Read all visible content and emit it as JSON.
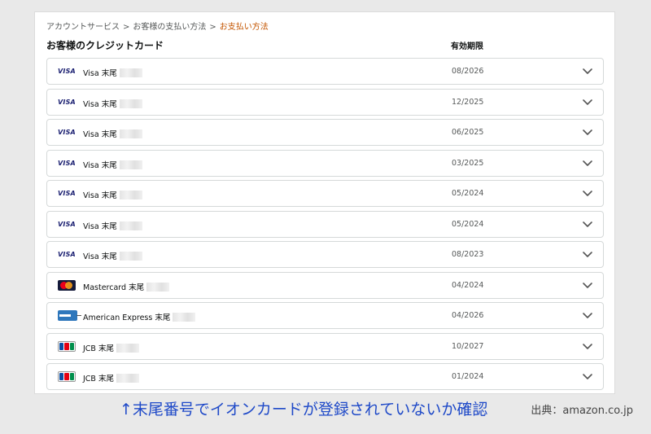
{
  "breadcrumb": {
    "items": [
      "アカウントサービス",
      "お客様の支払い方法"
    ],
    "separator": ">",
    "current": "お支払い方法"
  },
  "section_title": "お客様のクレジットカード",
  "expiry_header": "有効期限",
  "cards": [
    {
      "brand": "visa",
      "logo_text": "VISA",
      "label": "Visa 末尾",
      "expiry": "08/2026"
    },
    {
      "brand": "visa",
      "logo_text": "VISA",
      "label": "Visa 末尾",
      "expiry": "12/2025"
    },
    {
      "brand": "visa",
      "logo_text": "VISA",
      "label": "Visa 末尾",
      "expiry": "06/2025"
    },
    {
      "brand": "visa",
      "logo_text": "VISA",
      "label": "Visa 末尾",
      "expiry": "03/2025"
    },
    {
      "brand": "visa",
      "logo_text": "VISA",
      "label": "Visa 末尾",
      "expiry": "05/2024"
    },
    {
      "brand": "visa",
      "logo_text": "VISA",
      "label": "Visa 末尾",
      "expiry": "05/2024"
    },
    {
      "brand": "visa",
      "logo_text": "VISA",
      "label": "Visa 末尾",
      "expiry": "08/2023"
    },
    {
      "brand": "mastercard",
      "label": "Mastercard 末尾",
      "expiry": "04/2024"
    },
    {
      "brand": "amex",
      "label": "American Express 末尾",
      "expiry": "04/2026"
    },
    {
      "brand": "jcb",
      "label": "JCB 末尾",
      "expiry": "10/2027"
    },
    {
      "brand": "jcb",
      "label": "JCB 末尾",
      "expiry": "01/2024"
    }
  ],
  "caption": "↑末尾番号でイオンカードが登録されていないか確認",
  "source": "出典：amazon.co.jp",
  "colors": {
    "caption": "#1e49c8",
    "breadcrumb_current": "#c45500",
    "row_border": "#d5d9d9",
    "background": "#e9e9e9"
  }
}
